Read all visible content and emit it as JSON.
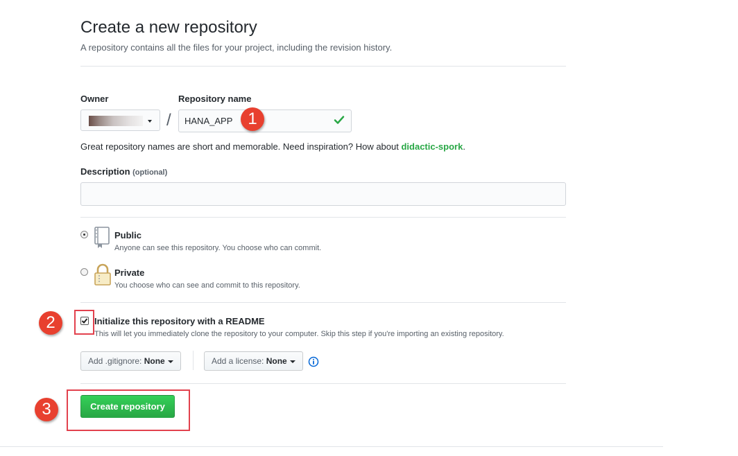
{
  "header": {
    "title": "Create a new repository",
    "subtitle": "A repository contains all the files for your project, including the revision history."
  },
  "owner": {
    "label": "Owner"
  },
  "repo": {
    "label": "Repository name",
    "value": "HANA_APP",
    "separator": "/"
  },
  "hint": {
    "prefix": "Great repository names are short and memorable. Need inspiration? How about ",
    "suggestion": "didactic-spork",
    "suffix": "."
  },
  "description": {
    "label": "Description",
    "optional": "(optional)",
    "value": ""
  },
  "visibility": {
    "selected": "public",
    "options": [
      {
        "title": "Public",
        "desc": "Anyone can see this repository. You choose who can commit."
      },
      {
        "title": "Private",
        "desc": "You choose who can see and commit to this repository."
      }
    ]
  },
  "init": {
    "checked": true,
    "title": "Initialize this repository with a README",
    "desc": "This will let you immediately clone the repository to your computer. Skip this step if you're importing an existing repository."
  },
  "gitignore": {
    "prefix": "Add .gitignore: ",
    "value": "None"
  },
  "license": {
    "prefix": "Add a license: ",
    "value": "None"
  },
  "submit": {
    "label": "Create repository"
  },
  "annotations": [
    "1",
    "2",
    "3"
  ],
  "colors": {
    "accent_green": "#28a745",
    "annotation_red": "#e8402f"
  }
}
